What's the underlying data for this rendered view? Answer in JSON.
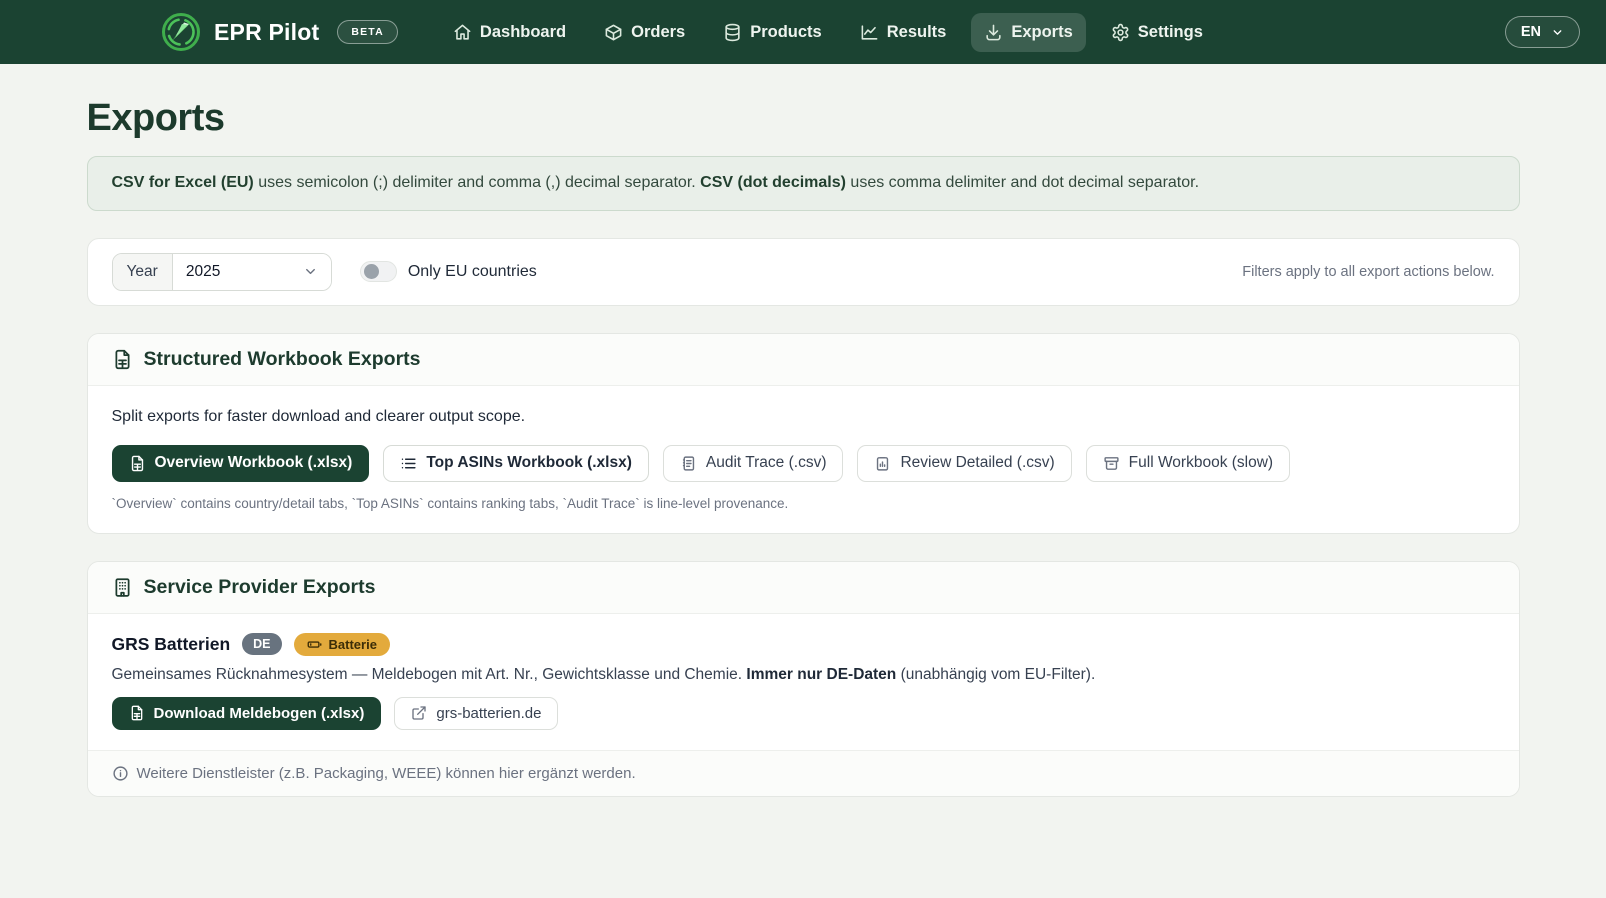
{
  "brand": {
    "name": "EPR Pilot",
    "beta_label": "BETA"
  },
  "nav": {
    "items": [
      {
        "label": "Dashboard",
        "icon": "home-icon",
        "active": false
      },
      {
        "label": "Orders",
        "icon": "package-icon",
        "active": false
      },
      {
        "label": "Products",
        "icon": "database-icon",
        "active": false
      },
      {
        "label": "Results",
        "icon": "chart-icon",
        "active": false
      },
      {
        "label": "Exports",
        "icon": "download-icon",
        "active": true
      },
      {
        "label": "Settings",
        "icon": "gear-icon",
        "active": false
      }
    ],
    "language": "EN"
  },
  "page": {
    "title": "Exports"
  },
  "banner": {
    "strong1": "CSV for Excel (EU)",
    "text1": " uses semicolon (;) delimiter and comma (,) decimal separator. ",
    "strong2": "CSV (dot decimals)",
    "text2": " uses comma delimiter and dot decimal separator."
  },
  "filters": {
    "year_label": "Year",
    "year_value": "2025",
    "eu_toggle_label": "Only EU countries",
    "eu_toggle_state": "off",
    "note": "Filters apply to all export actions below."
  },
  "workbook_card": {
    "title": "Structured Workbook Exports",
    "description": "Split exports for faster download and clearer output scope.",
    "buttons": [
      {
        "label": "Overview Workbook (.xlsx)",
        "variant": "primary",
        "icon": "spreadsheet-icon"
      },
      {
        "label": "Top ASINs Workbook (.xlsx)",
        "variant": "secondary-strong",
        "icon": "list-icon"
      },
      {
        "label": "Audit Trace (.csv)",
        "variant": "secondary",
        "icon": "document-lines-icon"
      },
      {
        "label": "Review Detailed (.csv)",
        "variant": "secondary",
        "icon": "clipboard-chart-icon"
      },
      {
        "label": "Full Workbook (slow)",
        "variant": "secondary",
        "icon": "archive-icon"
      }
    ],
    "footnote": "`Overview` contains country/detail tabs, `Top ASINs` contains ranking tabs, `Audit Trace` is line-level provenance."
  },
  "provider_card": {
    "title": "Service Provider Exports",
    "provider": {
      "name": "GRS Batterien",
      "country_badge": "DE",
      "category_badge": "Batterie",
      "description_1": "Gemeinsames Rücknahmesystem — Meldebogen mit Art. Nr., Gewichtsklasse und Chemie. ",
      "description_strong": "Immer nur DE-Daten",
      "description_2": " (unabhängig vom EU-Filter).",
      "download_button": "Download Meldebogen (.xlsx)",
      "website_button": "grs-batterien.de"
    },
    "footer_note": "Weitere Dienstleister (z.B. Packaging, WEEE) können hier ergänzt werden."
  },
  "colors": {
    "navbar_green": "#1b4332",
    "page_background": "#f2f4f0",
    "banner_background": "#e9efe9",
    "amber_badge": "#e3aa3c"
  }
}
